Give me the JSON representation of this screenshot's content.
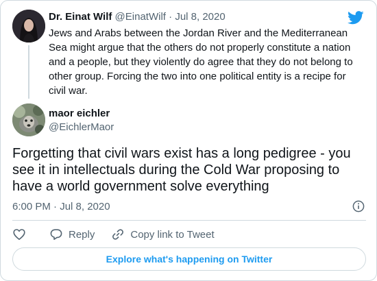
{
  "colors": {
    "brand": "#1d9bf0",
    "text": "#0f1419",
    "muted": "#536471",
    "border": "#cfd9de"
  },
  "parent_tweet": {
    "name": "Dr. Einat Wilf",
    "handle": "@EinatWilf",
    "separator": "·",
    "date": "Jul 8, 2020",
    "text": "Jews and Arabs between the Jordan River and the Mediterranean Sea might argue that the others do not properly constitute a nation and a people, but they violently do agree that they do not belong to other group. Forcing the two into one political entity is a recipe for civil war.",
    "avatar_icon": "profile-photo"
  },
  "brand_icon": "twitter-bird-icon",
  "main_tweet": {
    "name": "maor eichler",
    "handle": "@EichlerMaor",
    "text": "Forgetting that civil wars exist has a long pedigree - you see it in intellectuals during the Cold War proposing to have a world government solve everything",
    "timestamp": "6:00 PM · Jul 8, 2020",
    "avatar_icon": "profile-photo"
  },
  "actions": {
    "like_icon": "heart-icon",
    "reply_label": "Reply",
    "copy_link_label": "Copy link to Tweet"
  },
  "explore_label": "Explore what's happening on Twitter"
}
